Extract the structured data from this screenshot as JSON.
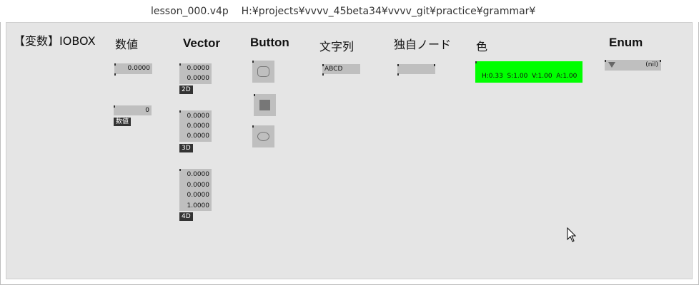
{
  "window": {
    "title": "lesson_000.v4p    H:¥projects¥vvvv_45beta34¥vvvv_git¥practice¥grammar¥"
  },
  "patch": {
    "main_heading": "【変数】IOBOX",
    "columns": {
      "number": "数値",
      "vector": "Vector",
      "button": "Button",
      "string": "文字列",
      "custom": "独自ノード",
      "color": "色",
      "enum": "Enum"
    },
    "number_box_1": {
      "value": "0.0000"
    },
    "number_box_2": {
      "value": "0",
      "tag": "数値"
    },
    "vector_2d": {
      "values": [
        "0.0000",
        "0.0000"
      ],
      "tag": "2D"
    },
    "vector_3d": {
      "values": [
        "0.0000",
        "0.0000",
        "0.0000"
      ],
      "tag": "3D"
    },
    "vector_4d": {
      "values": [
        "0.0000",
        "0.0000",
        "0.0000",
        "1.0000"
      ],
      "tag": "4D"
    },
    "string_box": {
      "value": "ABCD"
    },
    "custom_box": {
      "value": ""
    },
    "color_box": {
      "value": "H:0.33  S:1.00  V:1.00  A:1.00",
      "color": "#00ff00"
    },
    "enum_box": {
      "value": "(nil)"
    }
  }
}
